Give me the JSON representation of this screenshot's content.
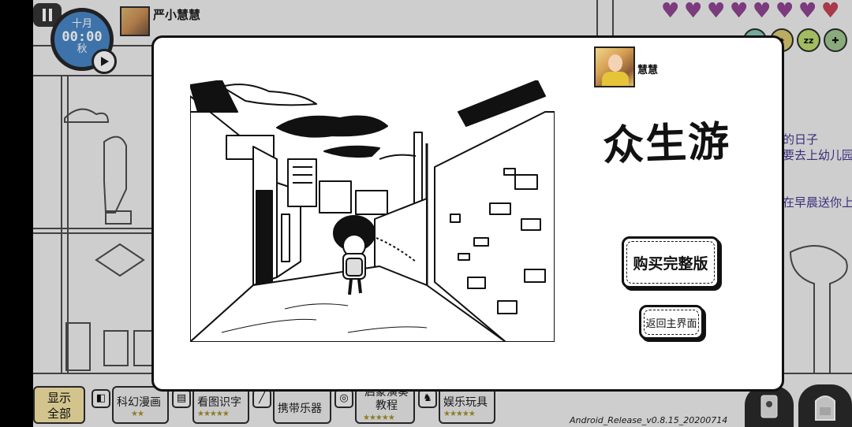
{
  "hud": {
    "clock": {
      "month": "十月",
      "time": "00:00",
      "season": "秋"
    },
    "player_name": "严小慧慧",
    "hearts": {
      "total": 8,
      "purple": 7,
      "red": 1
    },
    "status_icons": [
      "happy-icon",
      "star-icon",
      "sleep-icon",
      "hunger-icon"
    ]
  },
  "background": {
    "side_text": [
      "的日子",
      "要去上幼儿园",
      "在早晨送你上"
    ]
  },
  "modal": {
    "username": "慧慧",
    "title": "众生游",
    "buy_button": "购买完整版",
    "back_button": "返回主界面"
  },
  "toolbar": {
    "show_all": "显示\n全部",
    "items": [
      {
        "label": "科幻漫画",
        "stars": "★★",
        "icon": "speaker-icon"
      },
      {
        "label": "看图识字",
        "stars": "★★★★★",
        "icon": "book-icon"
      },
      {
        "label": "携带乐器",
        "stars": "",
        "icon": "flute-icon"
      },
      {
        "label": "启蒙演奏教程",
        "stars": "★★★★★",
        "icon": "disc-icon"
      },
      {
        "label": "娱乐玩具",
        "stars": "★★★★★",
        "icon": "toy-icon"
      }
    ],
    "version": "Android_Release_v0.8.15_20200714"
  },
  "colors": {
    "clock_blue": "#3d7fc2",
    "heart_purple": "#8a3a8e",
    "heart_red": "#c23a4a",
    "show_all_bg": "#f5e2a0"
  }
}
